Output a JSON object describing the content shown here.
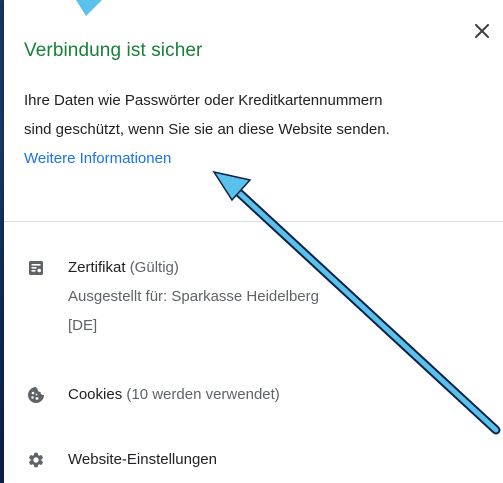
{
  "popup": {
    "title": "Verbindung ist sicher",
    "description_line1": "Ihre Daten wie Passwörter oder Kreditkartennummern",
    "description_line2": "sind geschützt, wenn Sie sie an diese Website senden.",
    "more_info_link": "Weitere Informationen",
    "close_icon": "close-icon"
  },
  "certificate": {
    "icon": "certificate-icon",
    "label": "Zertifikat",
    "status": "(Gültig)",
    "issued_to_line1": "Ausgestellt für: Sparkasse Heidelberg",
    "issued_to_line2": "[DE]"
  },
  "cookies": {
    "icon": "cookie-icon",
    "label": "Cookies",
    "status": "(10 werden verwendet)"
  },
  "site_settings": {
    "icon": "gear-icon",
    "label": "Website-Einstellungen"
  },
  "colors": {
    "title_green": "#188038",
    "link_blue": "#1a73e8",
    "annotation_arrow": "#5bc0eb"
  }
}
